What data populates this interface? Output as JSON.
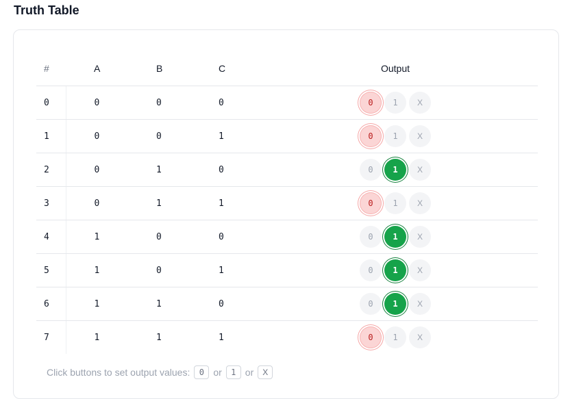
{
  "page_title": "Truth Table",
  "headers": {
    "index": "#",
    "a": "A",
    "b": "B",
    "c": "C",
    "output": "Output"
  },
  "option_labels": {
    "zero": "0",
    "one": "1",
    "dont_care": "X"
  },
  "rows": [
    {
      "index": "0",
      "a": "0",
      "b": "0",
      "c": "0",
      "output": "0"
    },
    {
      "index": "1",
      "a": "0",
      "b": "0",
      "c": "1",
      "output": "0"
    },
    {
      "index": "2",
      "a": "0",
      "b": "1",
      "c": "0",
      "output": "1"
    },
    {
      "index": "3",
      "a": "0",
      "b": "1",
      "c": "1",
      "output": "0"
    },
    {
      "index": "4",
      "a": "1",
      "b": "0",
      "c": "0",
      "output": "1"
    },
    {
      "index": "5",
      "a": "1",
      "b": "0",
      "c": "1",
      "output": "1"
    },
    {
      "index": "6",
      "a": "1",
      "b": "1",
      "c": "0",
      "output": "1"
    },
    {
      "index": "7",
      "a": "1",
      "b": "1",
      "c": "1",
      "output": "0"
    }
  ],
  "hint": {
    "text": "Click buttons to set output values:",
    "key_0": "0",
    "or_1": "or",
    "key_1": "1",
    "or_2": "or",
    "key_x": "X"
  },
  "colors": {
    "selected_zero_bg": "#fbd5d5",
    "selected_one_bg": "#16a34a",
    "unselected_bg": "#f3f4f6"
  }
}
